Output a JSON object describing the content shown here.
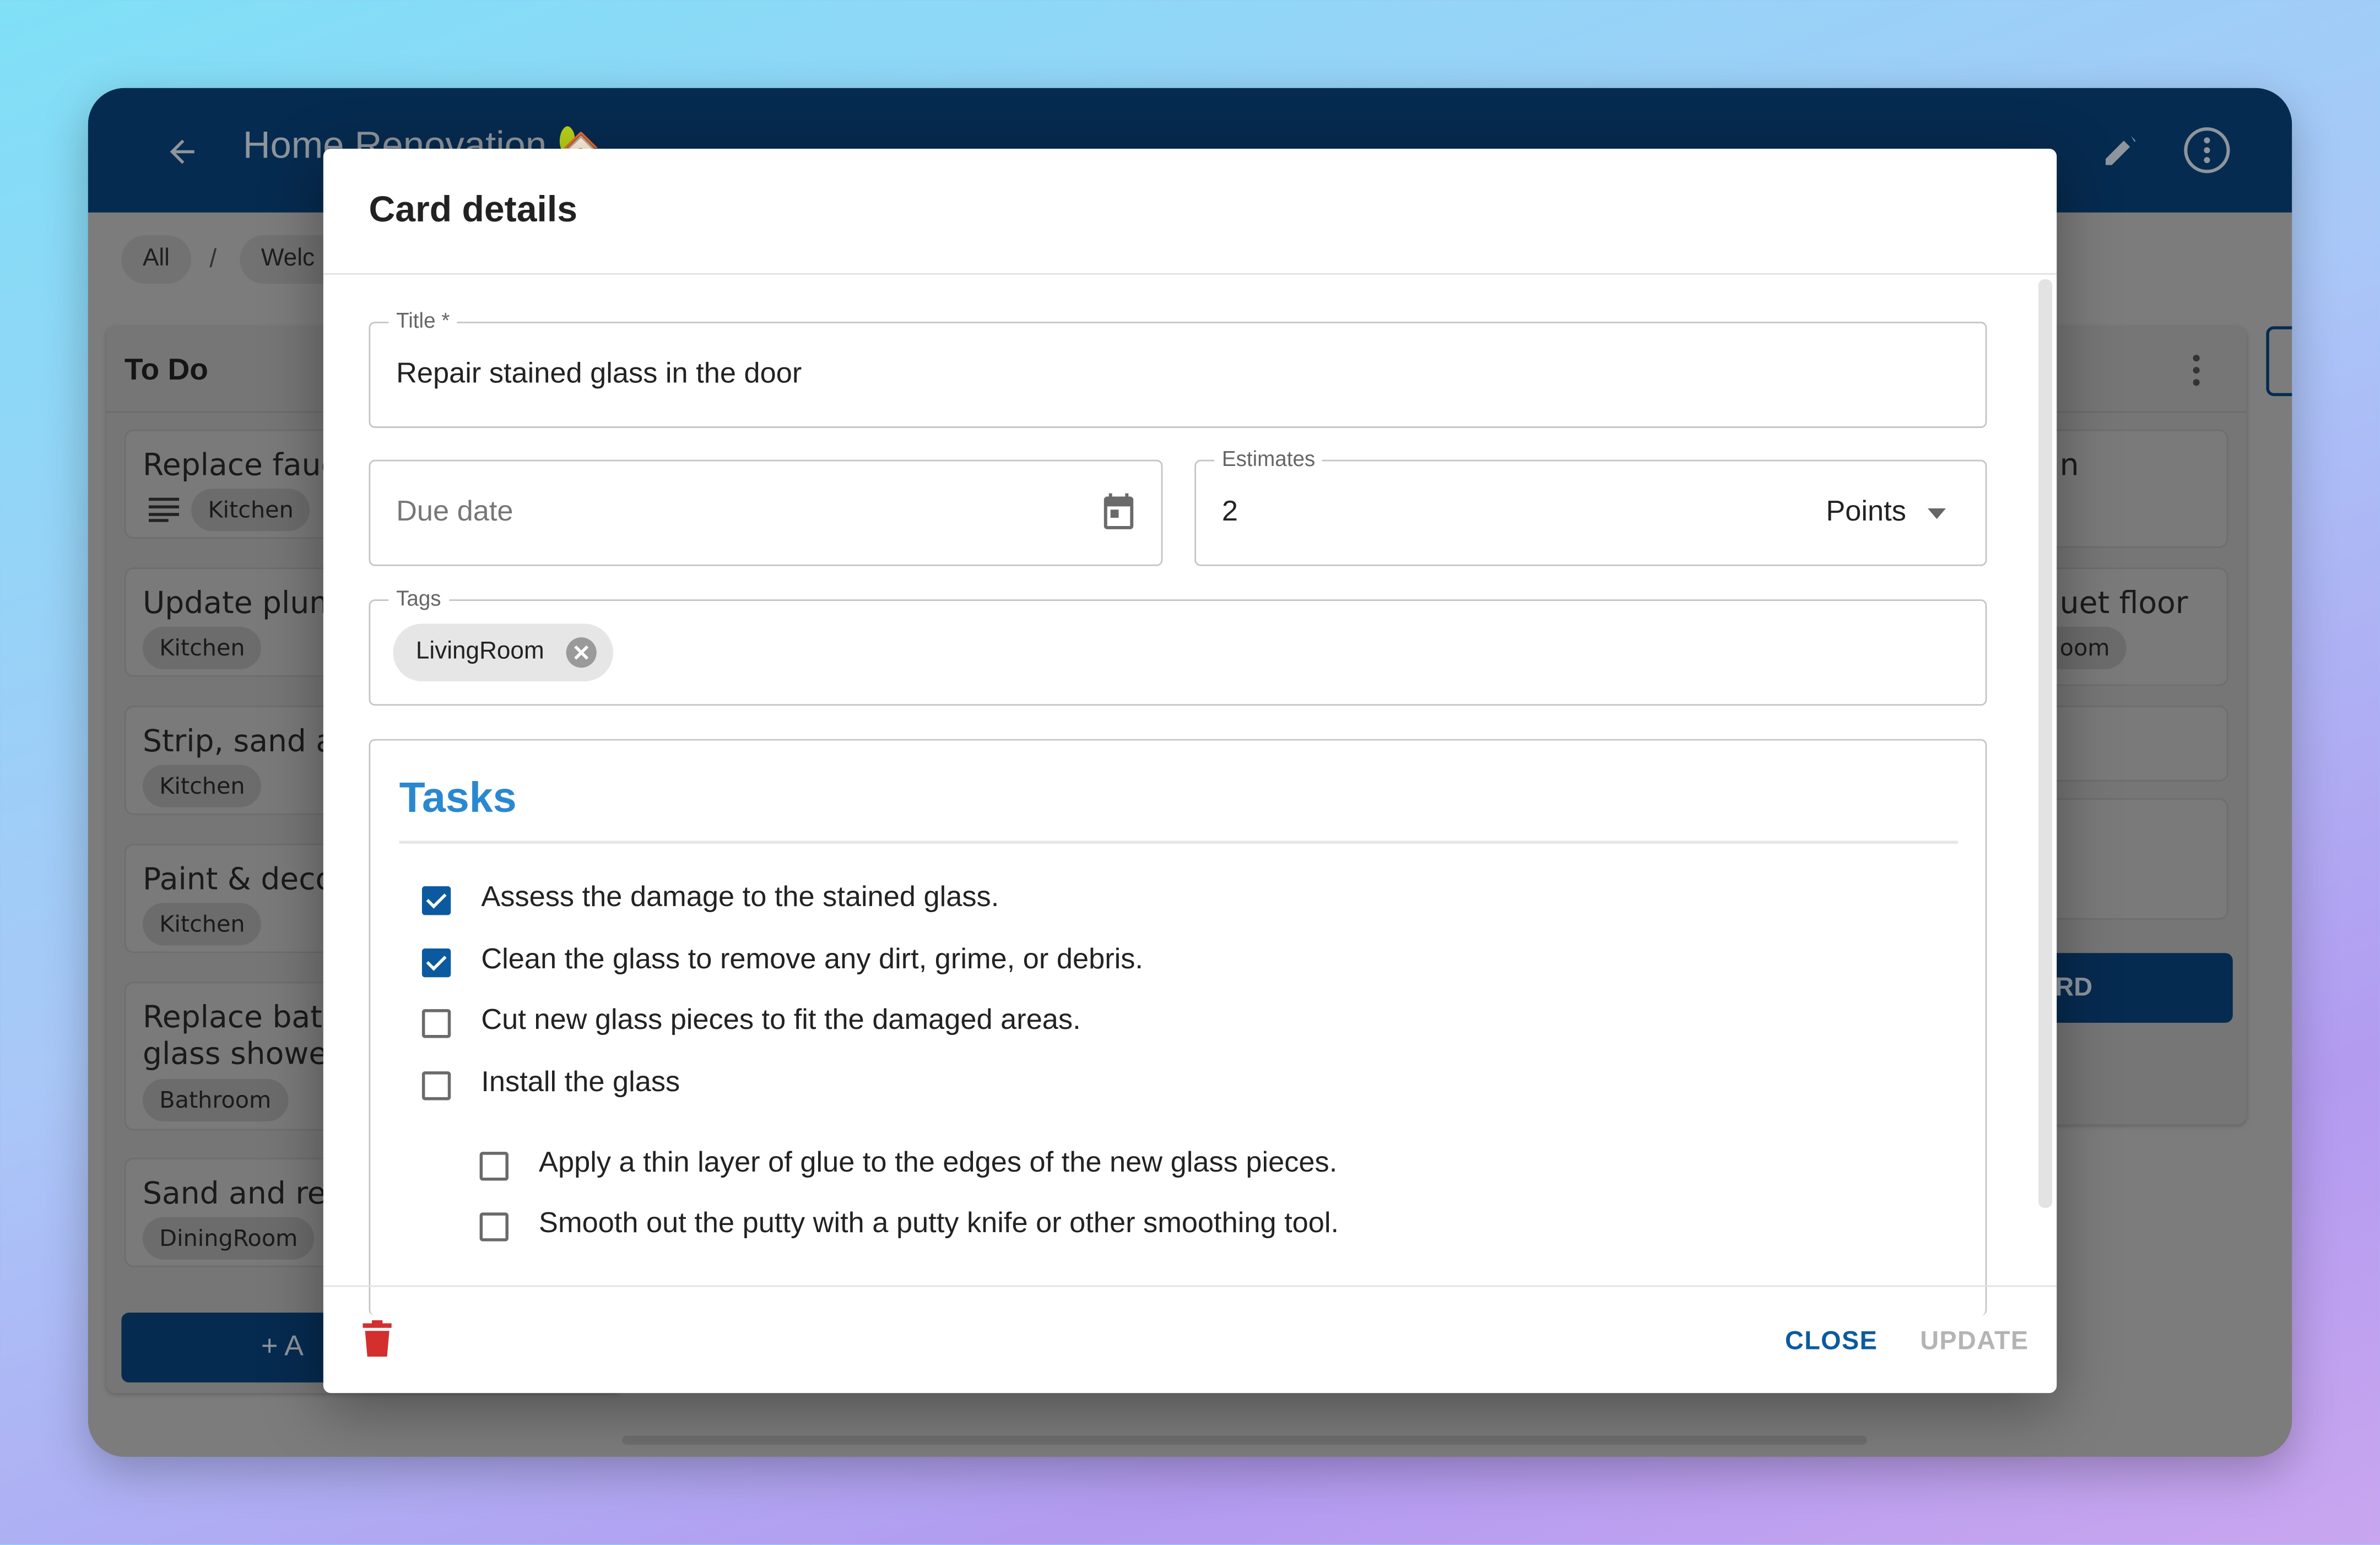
{
  "app": {
    "title": "Home Renovation",
    "title_emoji": "🏡",
    "breadcrumb": [
      "All",
      "/",
      "Welc"
    ],
    "columns": [
      {
        "title": "To Do",
        "cards": [
          {
            "title": "Replace fauc",
            "tag": "Kitchen",
            "has_description": true
          },
          {
            "title": "Update plum",
            "tag": "Kitchen"
          },
          {
            "title": "Strip, sand ar",
            "tag": "Kitchen"
          },
          {
            "title": "Paint & decor",
            "tag": "Kitchen"
          },
          {
            "title": "Replace bath\nglass shower",
            "tag": "Bathroom"
          },
          {
            "title": "Sand and rep",
            "tag": "DiningRoom"
          }
        ],
        "add_label": "+ A"
      },
      {
        "cards": [
          {
            "title": "n"
          },
          {
            "title": "uet floor",
            "tag": "oom"
          },
          {
            "title": ""
          },
          {
            "title": ""
          }
        ],
        "add_label": "RD"
      }
    ]
  },
  "dialog": {
    "title": "Card details",
    "fields": {
      "title_label": "Title *",
      "title_value": "Repair stained glass in the door",
      "due_date_placeholder": "Due date",
      "estimates_label": "Estimates",
      "estimates_value": "2",
      "estimates_unit": "Points",
      "tags_label": "Tags",
      "tags": [
        "LivingRoom"
      ]
    },
    "tasks_heading": "Tasks",
    "tasks": [
      {
        "text": "Assess the damage to the stained glass.",
        "checked": true,
        "level": 0
      },
      {
        "text": "Clean the glass to remove any dirt, grime, or debris.",
        "checked": true,
        "level": 0
      },
      {
        "text": "Cut new glass pieces to fit the damaged areas.",
        "checked": false,
        "level": 0
      },
      {
        "text": "Install the glass",
        "checked": false,
        "level": 0
      },
      {
        "text": "Apply a thin layer of glue to the edges of the new glass pieces.",
        "checked": false,
        "level": 1
      },
      {
        "text": "Smooth out the putty with a putty knife or other smoothing tool.",
        "checked": false,
        "level": 1
      }
    ],
    "close_label": "CLOSE",
    "update_label": "UPDATE"
  },
  "colors": {
    "header": "#062b50",
    "accent": "#0b5aa0",
    "tasks_heading": "#2a88d0",
    "delete": "#d32f2f"
  }
}
